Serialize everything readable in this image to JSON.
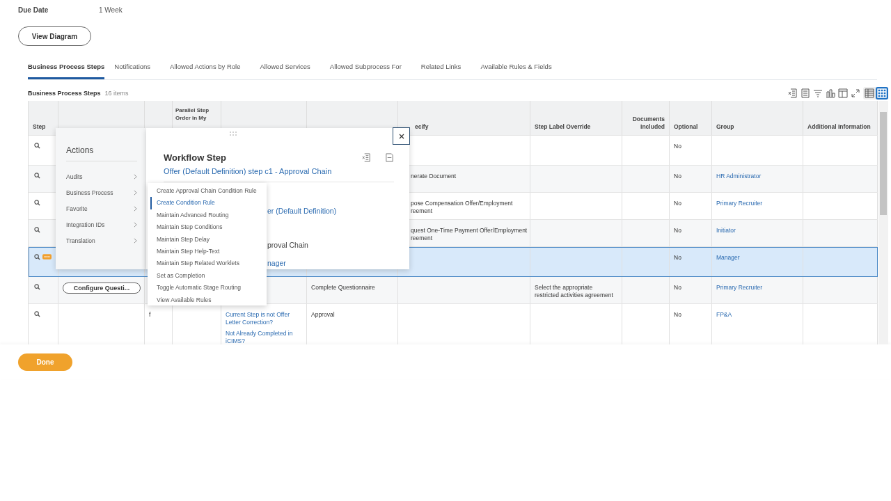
{
  "due_date": {
    "label": "Due Date",
    "value": "1 Week"
  },
  "view_diagram_button": "View Diagram",
  "tabs": [
    {
      "label": "Business Process Steps",
      "selected": true
    },
    {
      "label": "Notifications",
      "selected": false
    },
    {
      "label": "Allowed Actions by Role",
      "selected": false
    },
    {
      "label": "Allowed Services",
      "selected": false
    },
    {
      "label": "Allowed Subprocess For",
      "selected": false
    },
    {
      "label": "Related Links",
      "selected": false
    },
    {
      "label": "Available Rules & Fields",
      "selected": false
    }
  ],
  "table": {
    "title": "Business Process Steps",
    "count": "16 items",
    "columns": [
      {
        "label": "Step"
      },
      {},
      {},
      {
        "label": "Parallel Step Order in My"
      },
      {},
      {},
      {
        "label": "ecify"
      },
      {
        "label": "Step Label Override"
      },
      {
        "label": "Documents Included"
      },
      {
        "label": "Optional"
      },
      {
        "label": "Group"
      },
      {
        "label": "Additional Information"
      }
    ],
    "rows": [
      {
        "selected": false,
        "badge": false,
        "specify": [],
        "optional": "No"
      },
      {
        "selected": false,
        "badge": false,
        "specify": [
          "nerate Document"
        ],
        "optional": "No",
        "group": "HR Administrator"
      },
      {
        "selected": false,
        "badge": false,
        "specify": [
          "pose Compensation Offer/Employment",
          "reement"
        ],
        "optional": "No",
        "group": "Primary Recruiter"
      },
      {
        "selected": false,
        "badge": false,
        "specify": [
          "quest One-Time Payment Offer/Employment",
          "reement"
        ],
        "optional": "No",
        "group": "Initiator"
      },
      {
        "selected": true,
        "badge": true,
        "specify": [],
        "optional": "No",
        "group": "Manager"
      },
      {
        "selected": false,
        "badge": false,
        "button": "Configure Questi...",
        "type": "Complete Questionnaire",
        "specify": [],
        "step_label_override": "Select the appropriate restricted activities agreement",
        "optional": "No",
        "group": "Primary Recruiter"
      },
      {
        "selected": false,
        "badge": false,
        "order": "f",
        "conditions": [
          "Current Step is not Offer Letter Correction?",
          "Not Already Completed in iCIMS?"
        ],
        "type": "Approval",
        "specify": [],
        "optional": "No",
        "group": "FP&A"
      }
    ]
  },
  "actions_menu": {
    "title": "Actions",
    "items": [
      "Audits",
      "Business Process",
      "Favorite",
      "Integration IDs",
      "Translation"
    ]
  },
  "workflow_step": {
    "title": "Workflow Step",
    "subtitle": "Offer (Default Definition) step c1 - Approval Chain",
    "fragments": [
      {
        "kind": "link",
        "text": "er (Default Definition)"
      },
      {
        "kind": "text",
        "text": "proval Chain"
      },
      {
        "kind": "link",
        "text": "nager"
      }
    ]
  },
  "submenu": [
    {
      "label": "Create Approval Chain Condition Rule",
      "selected": false
    },
    {
      "label": "Create Condition Rule",
      "selected": true
    },
    {
      "label": "Maintain Advanced Routing",
      "selected": false
    },
    {
      "label": "Maintain Step Conditions",
      "selected": false
    },
    {
      "label": "Maintain Step Delay",
      "selected": false
    },
    {
      "label": "Maintain Step Help-Text",
      "selected": false
    },
    {
      "label": "Maintain Step Related Worklets",
      "selected": false
    },
    {
      "label": "Set as Completion",
      "selected": false
    },
    {
      "label": "Toggle Automatic Stage Routing",
      "selected": false
    },
    {
      "label": "View Available Rules",
      "selected": false
    }
  ],
  "done_button": "Done"
}
